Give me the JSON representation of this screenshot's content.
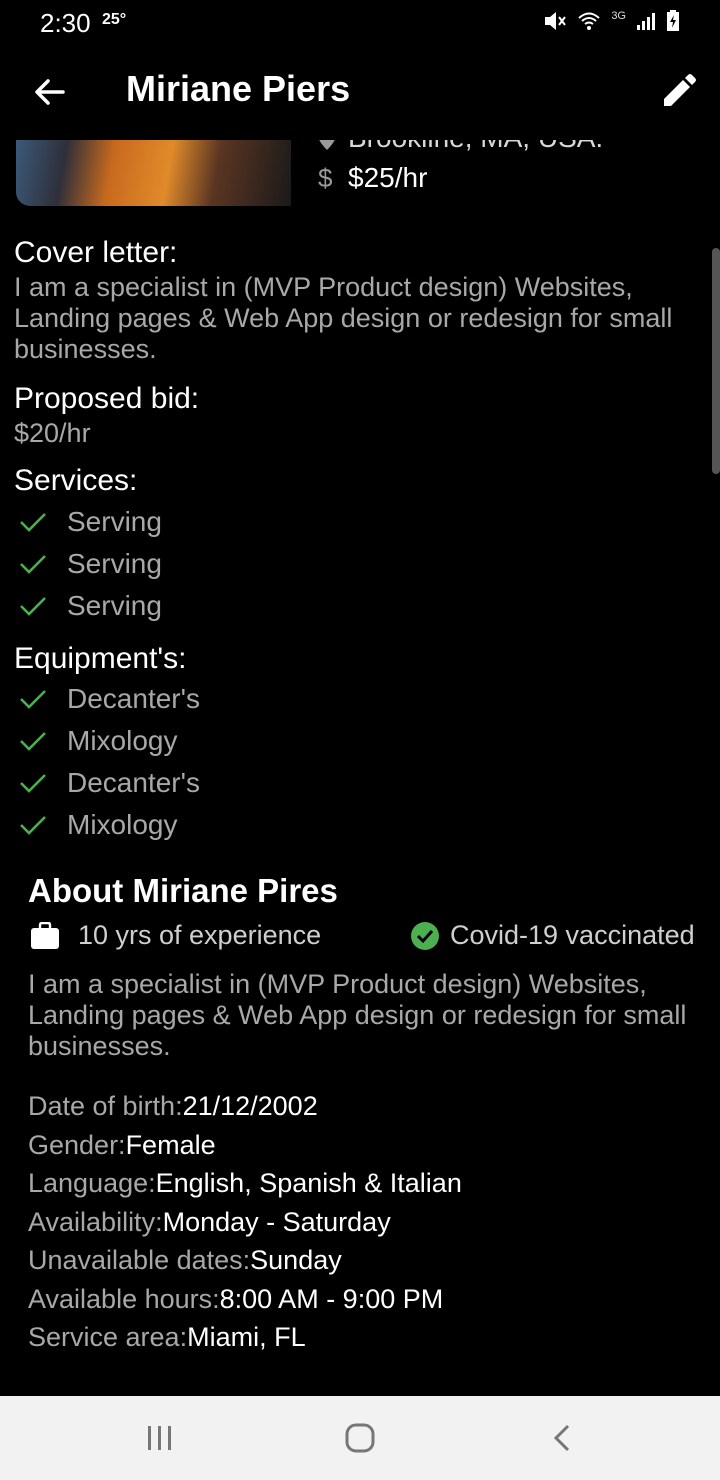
{
  "status_bar": {
    "time": "2:30",
    "temperature": "25°",
    "network": "3G"
  },
  "app_bar": {
    "title": "Miriane Piers",
    "back_icon": "arrow-left-icon",
    "edit_icon": "pencil-icon"
  },
  "profile_header": {
    "location": "Brookline, MA, USA.",
    "rate": "$25/hr",
    "rate_icon": "dollar-icon"
  },
  "cover_letter": {
    "label": "Cover letter:",
    "lines": [
      "I am a specialist in (MVP Product design) Websites,",
      "Landing pages & Web App design or redesign for small",
      "businesses."
    ]
  },
  "proposed_bid": {
    "label": "Proposed bid:",
    "value": "$20/hr"
  },
  "services": {
    "label": "Services:",
    "items": [
      "Serving",
      "Serving",
      "Serving"
    ]
  },
  "equipment": {
    "label": "Equipment's:",
    "items": [
      "Decanter's",
      "Mixology",
      "Decanter's",
      "Mixology"
    ]
  },
  "about": {
    "title": "About Miriane Pires",
    "experience": "10 yrs of experience",
    "vaccination": "Covid-19 vaccinated",
    "bio_lines": [
      "I am a specialist in (MVP Product design) Websites,",
      "Landing pages & Web App design or redesign for small",
      "businesses."
    ],
    "details": [
      {
        "key": "Date of birth:",
        "value": "21/12/2002"
      },
      {
        "key": "Gender:",
        "value": "Female"
      },
      {
        "key": "Language:",
        "value": "English, Spanish & Italian"
      },
      {
        "key": "Availability:",
        "value": "Monday - Saturday"
      },
      {
        "key": "Unavailable dates:",
        "value": "Sunday"
      },
      {
        "key": "Available hours:",
        "value": "8:00 AM - 9:00 PM"
      },
      {
        "key": "Service area:",
        "value": "Miami, FL"
      }
    ]
  },
  "colors": {
    "background": "#000000",
    "check_green": "#4caf50",
    "muted_text": "#a8a8a8",
    "nav_bar": "#f2f2f2"
  }
}
